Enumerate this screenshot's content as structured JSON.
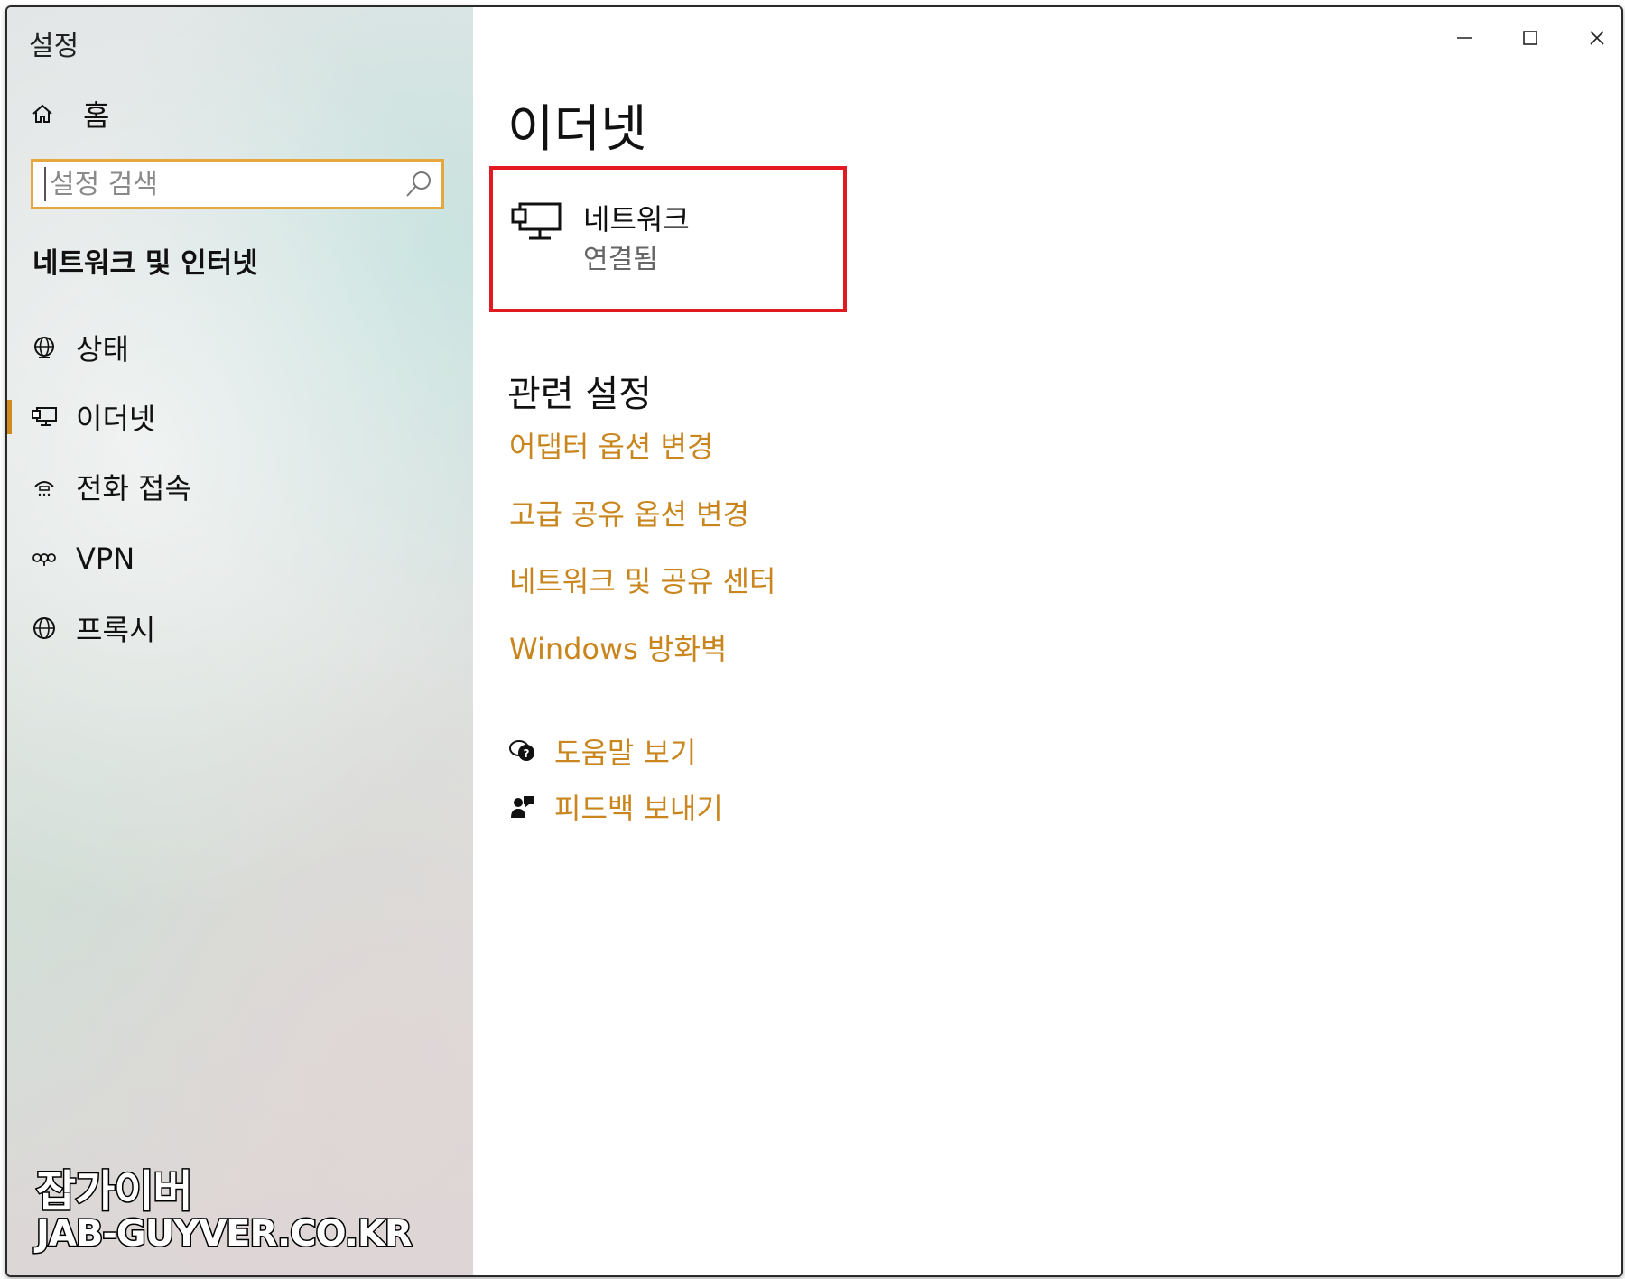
{
  "window": {
    "title": "설정",
    "controls": {
      "minimize_icon": "minimize-icon",
      "maximize_icon": "maximize-icon",
      "close_icon": "close-icon"
    }
  },
  "sidebar": {
    "home_label": "홈",
    "search_placeholder": "설정 검색",
    "section_title": "네트워크 및 인터넷",
    "items": [
      {
        "label": "상태",
        "icon": "globe-status-icon",
        "active": false
      },
      {
        "label": "이더넷",
        "icon": "ethernet-icon",
        "active": true
      },
      {
        "label": "전화 접속",
        "icon": "dialup-icon",
        "active": false
      },
      {
        "label": "VPN",
        "icon": "vpn-icon",
        "active": false
      },
      {
        "label": "프록시",
        "icon": "globe-icon",
        "active": false
      }
    ],
    "watermark": {
      "line1": "잡가이버",
      "line2": "JAB-GUYVER.CO.KR"
    }
  },
  "main": {
    "page_title": "이더넷",
    "network": {
      "name": "네트워크",
      "status": "연결됨",
      "highlight_color": "#e21b23"
    },
    "related_title": "관련 설정",
    "related_links": [
      "어댑터 옵션 변경",
      "고급 공유 옵션 변경",
      "네트워크 및 공유 센터",
      "Windows 방화벽"
    ],
    "help": {
      "get_help": "도움말 보기",
      "feedback": "피드백 보내기"
    }
  },
  "colors": {
    "accent": "#c9861e",
    "search_border": "#e6a83e",
    "active_indicator": "#d08a1e"
  }
}
